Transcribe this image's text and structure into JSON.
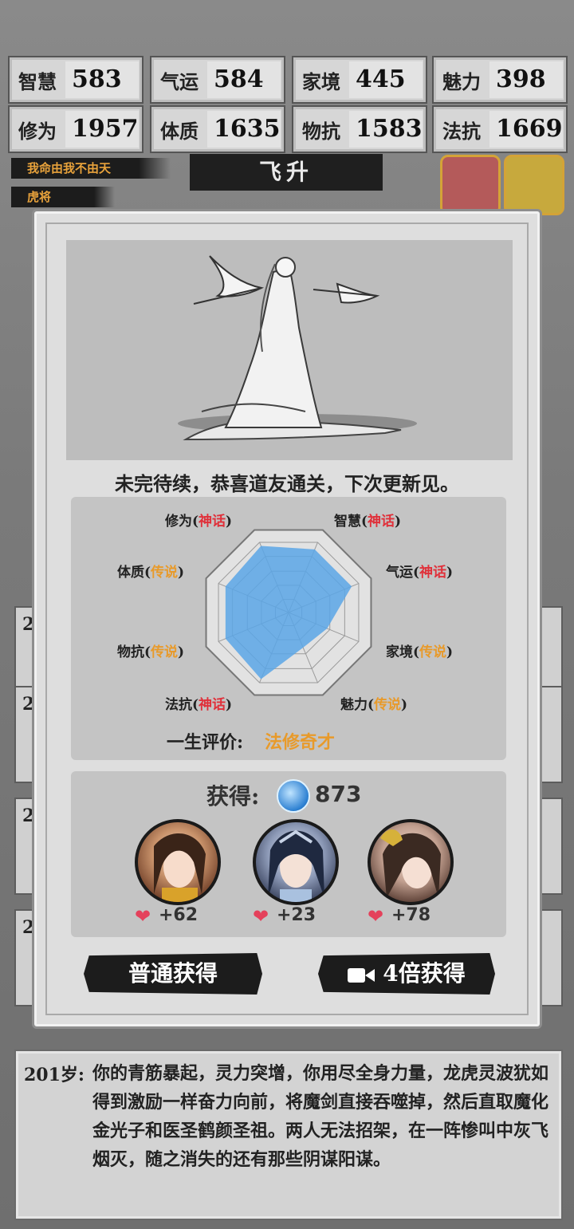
{
  "stats": [
    {
      "label": "智慧",
      "value": "583"
    },
    {
      "label": "气运",
      "value": "584"
    },
    {
      "label": "家境",
      "value": "445"
    },
    {
      "label": "魅力",
      "value": "398"
    },
    {
      "label": "修为",
      "value": "1957"
    },
    {
      "label": "体质",
      "value": "1635"
    },
    {
      "label": "物抗",
      "value": "1583"
    },
    {
      "label": "法抗",
      "value": "1669"
    }
  ],
  "motto": "我命由我不由天",
  "rank_tag": "虎将",
  "ascend_banner": "飞升",
  "background_log": [
    {
      "year": "2"
    },
    {
      "year": "2"
    },
    {
      "year": "2"
    },
    {
      "year": "2"
    }
  ],
  "modal": {
    "closing_text": "未完待续，恭喜道友通关，下次更新见。",
    "radar": {
      "axes": [
        {
          "name": "修为",
          "tier": "神话",
          "tier_type": "myth",
          "value": 0.95
        },
        {
          "name": "智慧",
          "tier": "神话",
          "tier_type": "myth",
          "value": 0.9
        },
        {
          "name": "气运",
          "tier": "神话",
          "tier_type": "myth",
          "value": 0.9
        },
        {
          "name": "家境",
          "tier": "传说",
          "tier_type": "legend",
          "value": 0.55
        },
        {
          "name": "魅力",
          "tier": "传说",
          "tier_type": "legend",
          "value": 0.5
        },
        {
          "name": "法抗",
          "tier": "神话",
          "tier_type": "myth",
          "value": 0.95
        },
        {
          "name": "物抗",
          "tier": "传说",
          "tier_type": "legend",
          "value": 0.9
        },
        {
          "name": "体质",
          "tier": "传说",
          "tier_type": "legend",
          "value": 0.9
        }
      ],
      "evaluation_label": "一生评价:",
      "evaluation_value": "法修奇才"
    },
    "reward": {
      "title": "获得:",
      "spirit_amount": "873",
      "companions": [
        {
          "affinity": "+62"
        },
        {
          "affinity": "+23"
        },
        {
          "affinity": "+78"
        }
      ]
    },
    "buttons": {
      "normal": "普通获得",
      "quadruple": "4倍获得"
    }
  },
  "story": {
    "age": "201岁:",
    "text": "你的青筋暴起，灵力突增，你用尽全身力量，龙虎灵波犹如得到激励一样奋力向前，将魔剑直接吞噬掉，然后直取魔化金光子和医圣鹤颜圣祖。两人无法招架，在一阵惨叫中灰飞烟灭，随之消失的还有那些阴谋阳谋。"
  },
  "colors": {
    "myth": "#e0303a",
    "legend": "#e89a2a",
    "radar_fill": "#5aa6e6"
  }
}
